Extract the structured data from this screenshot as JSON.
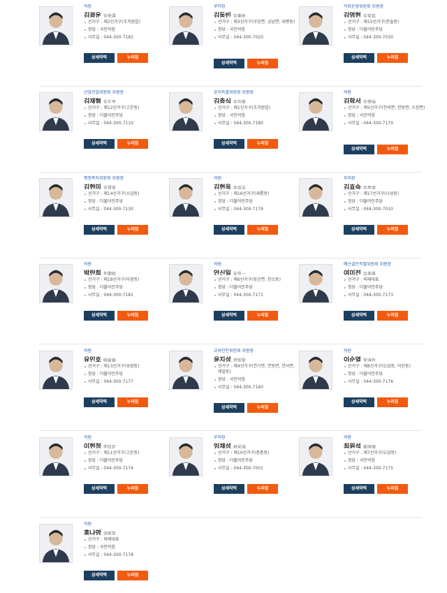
{
  "buttons": {
    "detail_label": "상세약력",
    "sns_label": "누리집"
  },
  "members": [
    {
      "role": "의장",
      "name": "김광운",
      "hanja": "金侊運",
      "details": [
        "선거구 : 제2선거구(조치원읍)",
        "정당 : 국민의힘",
        "사무실 : 044-300-7182"
      ]
    },
    {
      "role": "부의장",
      "name": "김동빈",
      "hanja": "金東彬",
      "details": [
        "선거구 : 제3선거구(부강면, 금남면, 대평동)",
        "정당 : 국민의힘",
        "사무실 : 044-300-7020"
      ]
    },
    {
      "role": "의회운영위원회 위원장",
      "name": "김영현",
      "hanja": "金英鉉",
      "details": [
        "선거구 : 제15선거구(한솔동)",
        "정당 : 더불어민주당",
        "사무실 : 044-300-7030"
      ]
    },
    {
      "role": "산업건설위원회 위원장",
      "name": "김재형",
      "hanja": "金在亨",
      "details": [
        "선거구 : 제12선거구(고운동)",
        "정당 : 더불어민주당",
        "사무실 : 044-300-7110"
      ]
    },
    {
      "role": "윤리특별위원회 위원장",
      "name": "김충식",
      "hanja": "金忠植",
      "details": [
        "선거구 : 제1선거구(조치원읍)",
        "정당 : 국민의힘",
        "사무실 : 044-300-7180"
      ]
    },
    {
      "role": "의원",
      "name": "김학서",
      "hanja": "金學瑞",
      "details": [
        "선거구 : 제5선거구(전의면, 전동면, 소정면)",
        "정당 : 국민의힘",
        "사무실 : 044-300-7170"
      ]
    },
    {
      "role": "행정복지위원회 위원장",
      "name": "김현미",
      "hanja": "金賢美",
      "details": [
        "선거구 : 제14선거구(소담동)",
        "정당 : 더불어민주당",
        "사무실 : 044-300-7130"
      ]
    },
    {
      "role": "의원",
      "name": "김현옥",
      "hanja": "金炫玉",
      "details": [
        "선거구 : 제16선거구(새롬동)",
        "정당 : 더불어민주당",
        "사무실 : 044-300-7179"
      ]
    },
    {
      "role": "부의장",
      "name": "김효숙",
      "hanja": "金孝淑",
      "details": [
        "선거구 : 제17선거구(나성동)",
        "정당 : 더불어민주당",
        "사무실 : 044-300-7010"
      ]
    },
    {
      "role": "의원",
      "name": "박란희",
      "hanja": "朴蘭姬",
      "details": [
        "선거구 : 제18선거구(다정동)",
        "정당 : 더불어민주당",
        "사무실 : 044-300-7181"
      ]
    },
    {
      "role": "의원",
      "name": "안신일",
      "hanja": "安信一",
      "details": [
        "선거구 : 제6선거구(장군면, 한소동)",
        "정당 : 더불어민주당",
        "사무실 : 044-300-7171"
      ]
    },
    {
      "role": "예산결산특별위원회 위원장",
      "name": "여미전",
      "hanja": "呂美典",
      "details": [
        "선거구 : 비례대표",
        "정당 : 더불어민주당",
        "사무실 : 044-300-7173"
      ]
    },
    {
      "role": "의원",
      "name": "유인호",
      "hanja": "柳寅鎬",
      "details": [
        "선거구 : 제13선거구(보람동)",
        "정당 : 더불어민주당",
        "사무실 : 044-300-7177"
      ]
    },
    {
      "role": "교육안전위원회 위원장",
      "name": "윤지성",
      "hanja": "尹智聖",
      "details": [
        "선거구 : 제4선거구(연기면, 연동면, 연서면, 해밀동)",
        "정당 : 국민의힘",
        "사무실 : 044-300-7140"
      ]
    },
    {
      "role": "의원",
      "name": "이순열",
      "hanja": "李淳烈",
      "details": [
        "선거구 : 제8선거구(도담동, 어진동)",
        "정당 : 더불어민주당",
        "사무실 : 044-300-7176"
      ]
    },
    {
      "role": "의원",
      "name": "이현정",
      "hanja": "李炫定",
      "details": [
        "선거구 : 제11선거구(고운동)",
        "정당 : 더불어민주당",
        "사무실 : 044-300-7174"
      ]
    },
    {
      "role": "부의장",
      "name": "임채성",
      "hanja": "林采城",
      "details": [
        "선거구 : 제10선거구(종촌동)",
        "정당 : 더불어민주당",
        "사무실 : 044-300-7001"
      ]
    },
    {
      "role": "의원",
      "name": "최원석",
      "hanja": "崔原碩",
      "details": [
        "선거구 : 제7선거구(도담동)",
        "정당 : 국민의힘",
        "사무실 : 044-300-7175"
      ]
    },
    {
      "role": "의원",
      "name": "홍나영",
      "hanja": "洪那英",
      "details": [
        "선거구 : 비례대표",
        "정당 : 국민의힘",
        "사무실 : 044-300-7178"
      ]
    }
  ]
}
